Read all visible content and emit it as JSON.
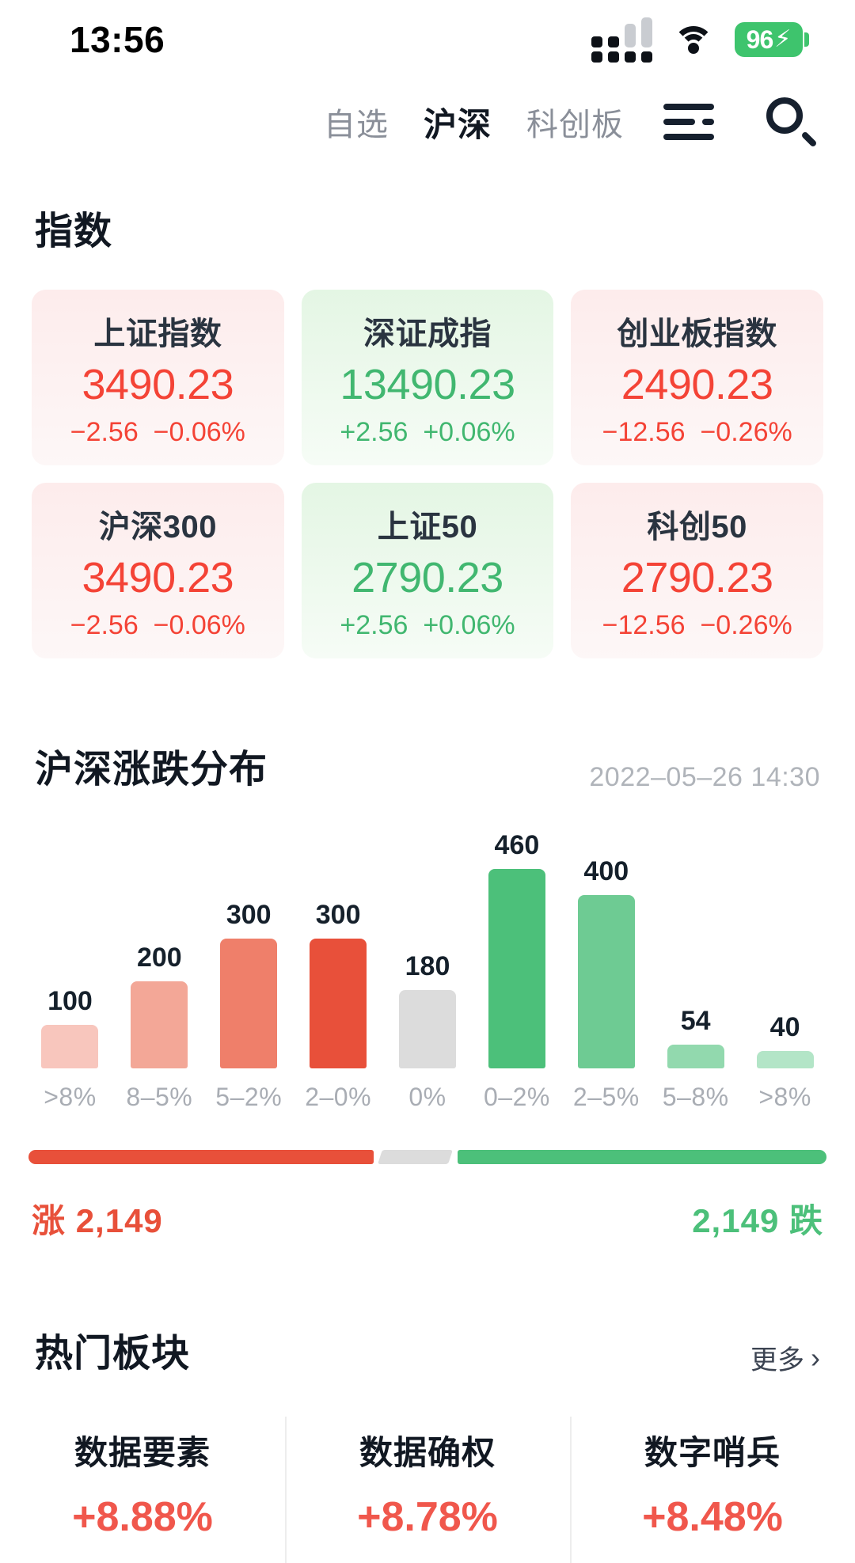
{
  "status_bar": {
    "time": "13:56",
    "battery_percent": "96",
    "charging_glyph": "⚡",
    "icons": [
      "signal-icon",
      "wifi-icon",
      "battery-icon"
    ]
  },
  "nav": {
    "tabs": [
      {
        "label": "自选",
        "active": false
      },
      {
        "label": "沪深",
        "active": true
      },
      {
        "label": "科创板",
        "active": false
      }
    ],
    "menu_icon": "hamburger-menu-icon",
    "search_icon": "search-icon"
  },
  "indices": {
    "title": "指数",
    "cards": [
      {
        "name": "上证指数",
        "value": "3490.23",
        "change": "−2.56",
        "percent": "−0.06%",
        "direction": "down"
      },
      {
        "name": "深证成指",
        "value": "13490.23",
        "change": "+2.56",
        "percent": "+0.06%",
        "direction": "up"
      },
      {
        "name": "创业板指数",
        "value": "2490.23",
        "change": "−12.56",
        "percent": "−0.26%",
        "direction": "down"
      },
      {
        "name": "沪深300",
        "value": "3490.23",
        "change": "−2.56",
        "percent": "−0.06%",
        "direction": "down"
      },
      {
        "name": "上证50",
        "value": "2790.23",
        "change": "+2.56",
        "percent": "+0.06%",
        "direction": "up"
      },
      {
        "name": "科创50",
        "value": "2790.23",
        "change": "−12.56",
        "percent": "−0.26%",
        "direction": "down"
      }
    ]
  },
  "distribution": {
    "title": "沪深涨跌分布",
    "timestamp": "2022–05–26 14:30",
    "summary": {
      "up_label": "涨",
      "up_count": "2,149",
      "down_label": "跌",
      "down_count": "2,149",
      "up_ratio": 44,
      "flat_ratio": 9,
      "down_ratio": 47
    }
  },
  "chart_data": {
    "type": "bar",
    "title": "沪深涨跌分布",
    "categories": [
      ">8%",
      "8–5%",
      "5–2%",
      "2–0%",
      "0%",
      "0–2%",
      "2–5%",
      "5–8%",
      ">8%"
    ],
    "values": [
      100,
      200,
      300,
      300,
      180,
      460,
      400,
      54,
      40
    ],
    "colors": [
      "#f8c6bd",
      "#f3a797",
      "#ef7f6a",
      "#e8503a",
      "#dcdcdc",
      "#4cc07a",
      "#6ecb93",
      "#92d9ae",
      "#b3e5c7"
    ],
    "xlabel": "",
    "ylabel": "",
    "ylim": [
      0,
      460
    ],
    "grid": false,
    "legend": "none",
    "data_labels": true
  },
  "hot_sectors": {
    "title": "热门板块",
    "more_label": "更多",
    "more_chevron": "›",
    "items": [
      {
        "name": "数据要素",
        "percent": "+8.88%"
      },
      {
        "name": "数据确权",
        "percent": "+8.78%"
      },
      {
        "name": "数字哨兵",
        "percent": "+8.48%"
      }
    ]
  },
  "colors": {
    "up_red": "#e8503a",
    "down_green": "#4cc07a",
    "flat_gray": "#dcdcdc",
    "battery_green": "#3ec46d"
  }
}
